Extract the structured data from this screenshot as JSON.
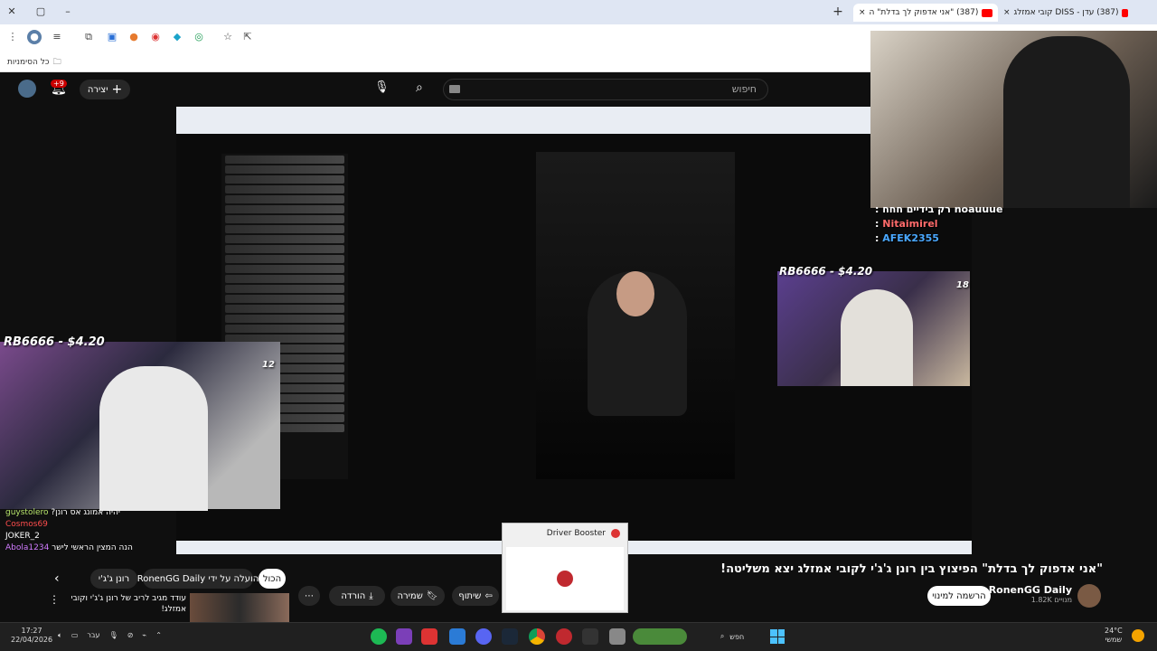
{
  "browser": {
    "tabs": [
      {
        "label": "(387) עדן - DISS קובי אמזלג"
      },
      {
        "label": "(387) \"אני אדפוק לך בדלת\" ה"
      }
    ],
    "new_tab": "+",
    "bookmarks_label": "כל הסימניות",
    "close_glyph": "✕",
    "minimize_glyph": "–",
    "restore_glyph": "▢",
    "close_tab_glyph": "×"
  },
  "youtube": {
    "create_label": "יצירה",
    "search_placeholder": "חיפוש",
    "notif_count": "+9"
  },
  "video": {
    "title": "\"אני אדפוק לך בדלת\" הפיצוץ בין רונן ג'ג'י לקובי אמזלג יצא משליטה!",
    "channel_name": "RonenGG Daily",
    "subscribers": "1.82K מנויים",
    "subscribe_label": "הרשמה למינוי",
    "share_label": "שיתוף",
    "save_label": "שמירה",
    "download_label": "הורדה",
    "more_label": "⋯"
  },
  "overlays": {
    "donation_left": "RB6666 - $4.20",
    "donation_mid": "RB6666 - $4.20",
    "badge_left": "12",
    "badge_mid": "18",
    "chat_right": [
      {
        "user": "noauuue",
        "text": "רק בידיים חחח :",
        "color": "#ffffff"
      },
      {
        "user": "Nitaimirel",
        "text": ":",
        "color": "#ff6b6b"
      },
      {
        "user": "AFEK2355",
        "text": ":",
        "color": "#4aa8ff"
      }
    ],
    "chat_left": [
      {
        "user": "guystolero",
        "text": "?יהיה אמונג אס רונן",
        "color": "#b7e46b"
      },
      {
        "user": "Cosmos69",
        "text": "",
        "color": "#ff4d4d"
      },
      {
        "user": "JOKER_2",
        "text": "",
        "color": "#ffffff"
      },
      {
        "user": "Abola1234",
        "text": "הנה המצין הראשי לישר",
        "color": "#d17cff"
      }
    ]
  },
  "related": {
    "chips": [
      "הכול",
      "הועלה על ידי RonenGG Daily",
      "רונן ג'ג'י"
    ],
    "next_title": "עודד מגיב לריב של רונן ג'ג'י וקובי אמזלג!"
  },
  "popup": {
    "title": "Driver Booster"
  },
  "taskbar": {
    "time": "17:27",
    "date": "22/04/2026",
    "lang": "עבר",
    "search_label": "חפש",
    "weather_temp": "24°C",
    "weather_desc": "שמשי"
  }
}
